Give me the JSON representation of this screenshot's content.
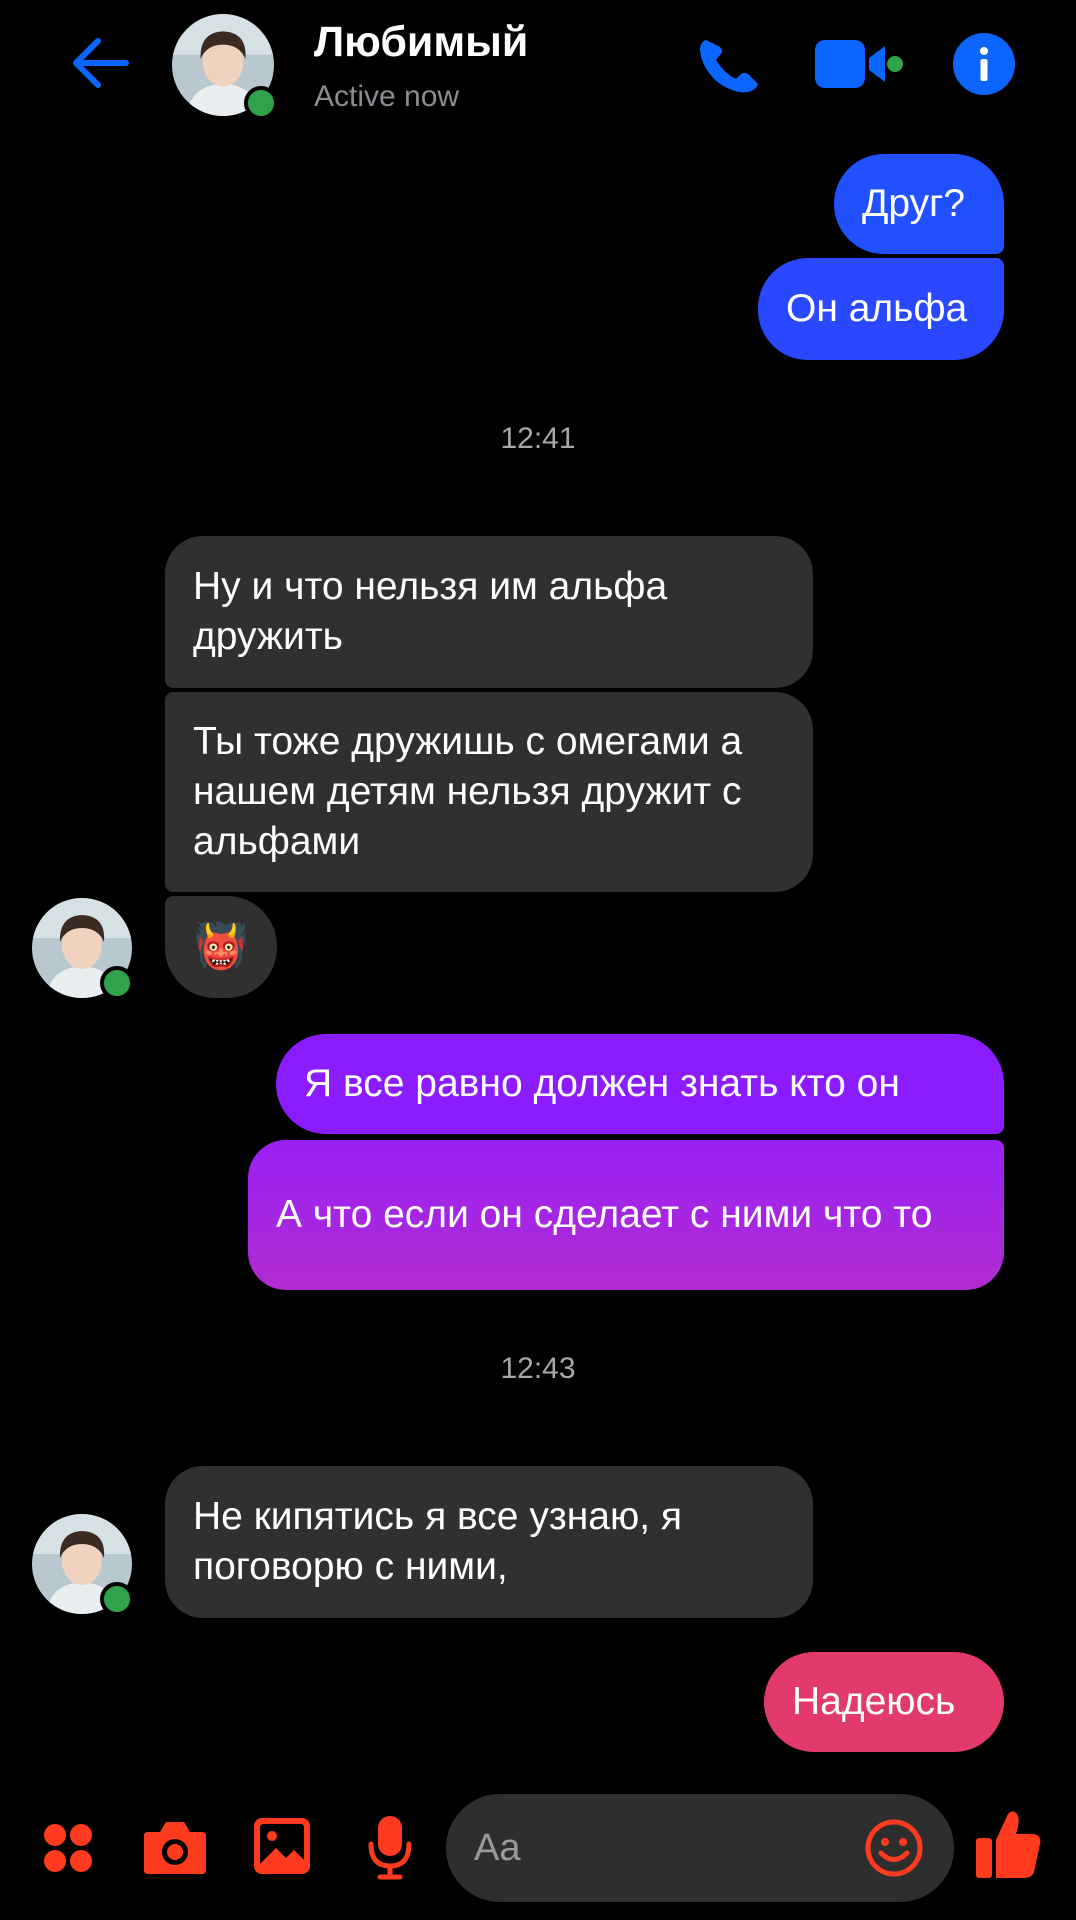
{
  "header": {
    "contact_name": "Любимый",
    "status": "Active now"
  },
  "messages": [
    {
      "dir": "out",
      "text": "Друг?"
    },
    {
      "dir": "out",
      "text": "Он альфа"
    },
    {
      "type": "time",
      "text": "12:41"
    },
    {
      "dir": "in",
      "text": "Ну и что нельзя им альфа дружить"
    },
    {
      "dir": "in",
      "text": "Ты тоже дружишь с омегами а нашем детям нельзя дружит с альфами"
    },
    {
      "dir": "in",
      "emoji": "👹"
    },
    {
      "dir": "out",
      "text": "Я все равно должен знать кто он"
    },
    {
      "dir": "out",
      "text": "А что если он сделает с ними что то"
    },
    {
      "type": "time",
      "text": "12:43"
    },
    {
      "dir": "in",
      "text": "Не кипятись я все узнаю, я поговорю с ними,"
    },
    {
      "dir": "out",
      "text": "Надеюсь"
    }
  ],
  "composer": {
    "placeholder": "Aa"
  },
  "colors": {
    "accent_blue": "#0a66ff",
    "composer_accent": "#ff3b1f",
    "incoming_bubble": "#303030",
    "online": "#31a24c"
  },
  "icons": [
    "back-arrow-icon",
    "phone-icon",
    "video-icon",
    "info-icon",
    "apps-icon",
    "camera-icon",
    "gallery-icon",
    "microphone-icon",
    "emoji-icon",
    "thumbs-up-icon"
  ]
}
